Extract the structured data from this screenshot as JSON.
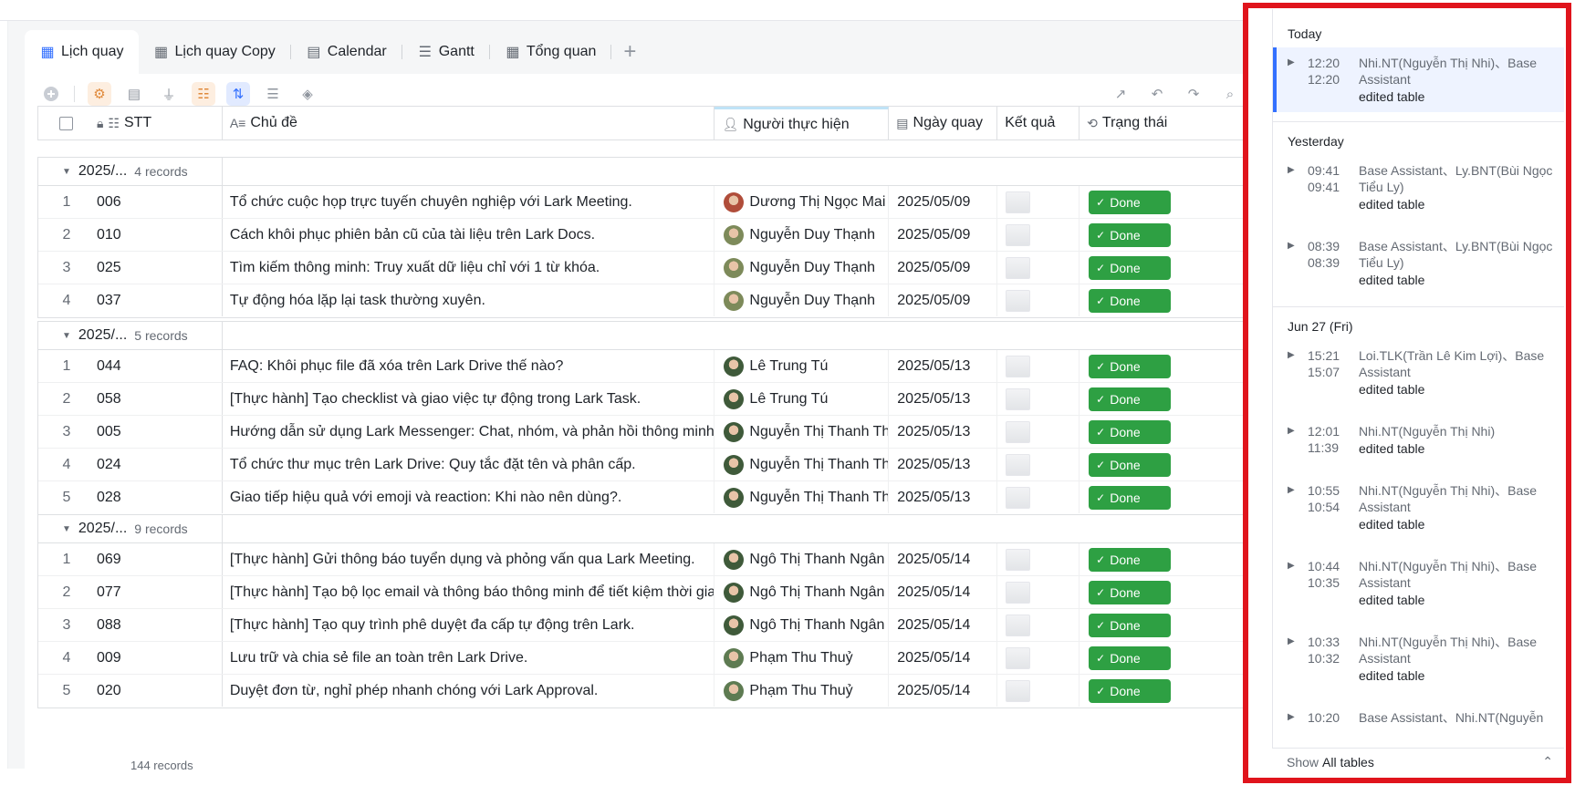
{
  "tabs": [
    {
      "label": "Lịch quay",
      "icon": "grid-icon",
      "active": true
    },
    {
      "label": "Lịch quay Copy",
      "icon": "grid-icon",
      "active": false
    },
    {
      "label": "Calendar",
      "icon": "calendar-icon",
      "active": false
    },
    {
      "label": "Gantt",
      "icon": "gantt-icon",
      "active": false
    },
    {
      "label": "Tổng quan",
      "icon": "grid-icon",
      "active": false
    }
  ],
  "tab_add": "+",
  "columns": {
    "stt": "STT",
    "topic": "Chủ đề",
    "person": "Người thực hiện",
    "date": "Ngày quay",
    "result": "Kết quả",
    "status": "Trạng thái"
  },
  "groups": [
    {
      "label": "2025/...",
      "count": "4 records",
      "rows": [
        {
          "idx": "1",
          "stt": "006",
          "topic": "Tổ chức cuộc họp trực tuyến chuyên nghiệp với Lark Meeting.",
          "person": "Dương Thị Ngọc Mai",
          "date": "2025/05/09",
          "status": "Done"
        },
        {
          "idx": "2",
          "stt": "010",
          "topic": "Cách khôi phục phiên bản cũ của tài liệu trên Lark Docs.",
          "person": "Nguyễn Duy Thạnh",
          "date": "2025/05/09",
          "status": "Done"
        },
        {
          "idx": "3",
          "stt": "025",
          "topic": "Tìm kiếm thông minh: Truy xuất dữ liệu chỉ với 1 từ khóa.",
          "person": "Nguyễn Duy Thạnh",
          "date": "2025/05/09",
          "status": "Done"
        },
        {
          "idx": "4",
          "stt": "037",
          "topic": "Tự động hóa lặp lại task thường xuyên.",
          "person": "Nguyễn Duy Thạnh",
          "date": "2025/05/09",
          "status": "Done"
        }
      ]
    },
    {
      "label": "2025/...",
      "count": "5 records",
      "rows": [
        {
          "idx": "1",
          "stt": "044",
          "topic": "FAQ: Khôi phục file đã xóa trên Lark Drive thế nào?",
          "person": "Lê Trung Tú",
          "date": "2025/05/13",
          "status": "Done"
        },
        {
          "idx": "2",
          "stt": "058",
          "topic": "[Thực hành] Tạo checklist và giao việc tự động trong Lark Task.",
          "person": "Lê Trung Tú",
          "date": "2025/05/13",
          "status": "Done"
        },
        {
          "idx": "3",
          "stt": "005",
          "topic": "Hướng dẫn sử dụng Lark Messenger: Chat, nhóm, và phản hồi thông minh.",
          "person": "Nguyễn Thị Thanh Thư",
          "date": "2025/05/13",
          "status": "Done"
        },
        {
          "idx": "4",
          "stt": "024",
          "topic": "Tổ chức thư mục trên Lark Drive: Quy tắc đặt tên và phân cấp.",
          "person": "Nguyễn Thị Thanh Thư",
          "date": "2025/05/13",
          "status": "Done"
        },
        {
          "idx": "5",
          "stt": "028",
          "topic": "Giao tiếp hiệu quả với emoji và reaction: Khi nào nên dùng?.",
          "person": "Nguyễn Thị Thanh Thư",
          "date": "2025/05/13",
          "status": "Done"
        }
      ]
    },
    {
      "label": "2025/...",
      "count": "9 records",
      "rows": [
        {
          "idx": "1",
          "stt": "069",
          "topic": "[Thực hành] Gửi thông báo tuyển dụng và phỏng vấn qua Lark Meeting.",
          "person": "Ngô Thị Thanh Ngân",
          "date": "2025/05/14",
          "status": "Done"
        },
        {
          "idx": "2",
          "stt": "077",
          "topic": "[Thực hành] Tạo bộ lọc email và thông báo thông minh để tiết kiệm thời gian.",
          "person": "Ngô Thị Thanh Ngân",
          "date": "2025/05/14",
          "status": "Done"
        },
        {
          "idx": "3",
          "stt": "088",
          "topic": "[Thực hành] Tạo quy trình phê duyệt đa cấp tự động trên Lark.",
          "person": "Ngô Thị Thanh Ngân",
          "date": "2025/05/14",
          "status": "Done"
        },
        {
          "idx": "4",
          "stt": "009",
          "topic": "Lưu trữ và chia sẻ file an toàn trên Lark Drive.",
          "person": "Phạm Thu Thuỷ",
          "date": "2025/05/14",
          "status": "Done"
        },
        {
          "idx": "5",
          "stt": "020",
          "topic": "Duyệt đơn từ, nghỉ phép nhanh chóng với Lark Approval.",
          "person": "Phạm Thu Thuỷ",
          "date": "2025/05/14",
          "status": "Done"
        }
      ]
    }
  ],
  "footer_count": "144 records",
  "history": {
    "sections": [
      {
        "title": "Today",
        "entries": [
          {
            "t1": "12:20",
            "t2": "12:20",
            "who": "Nhi.NT(Nguyễn Thị Nhi)、Base Assistant",
            "action": "edited table",
            "selected": true
          }
        ]
      },
      {
        "title": "Yesterday",
        "entries": [
          {
            "t1": "09:41",
            "t2": "09:41",
            "who": "Base Assistant、Ly.BNT(Bùi Ngọc Tiểu Ly)",
            "action": "edited table"
          },
          {
            "t1": "08:39",
            "t2": "08:39",
            "who": "Base Assistant、Ly.BNT(Bùi Ngọc Tiểu Ly)",
            "action": "edited table"
          }
        ]
      },
      {
        "title": "Jun 27 (Fri)",
        "entries": [
          {
            "t1": "15:21",
            "t2": "15:07",
            "who": "Loi.TLK(Trần Lê Kim Lợi)、Base Assistant",
            "action": "edited table"
          },
          {
            "t1": "12:01",
            "t2": "11:39",
            "who": "Nhi.NT(Nguyễn Thị Nhi)",
            "action": "edited table"
          },
          {
            "t1": "10:55",
            "t2": "10:54",
            "who": "Nhi.NT(Nguyễn Thị Nhi)、Base Assistant",
            "action": "edited table"
          },
          {
            "t1": "10:44",
            "t2": "10:35",
            "who": "Nhi.NT(Nguyễn Thị Nhi)、Base Assistant",
            "action": "edited table"
          },
          {
            "t1": "10:33",
            "t2": "10:32",
            "who": "Nhi.NT(Nguyễn Thị Nhi)、Base Assistant",
            "action": "edited table"
          },
          {
            "t1": "10:20",
            "t2": "",
            "who": "Base Assistant、Nhi.NT(Nguyễn",
            "action": ""
          }
        ]
      }
    ],
    "footer_show": "Show",
    "footer_scope": "All tables"
  },
  "colors": {
    "accent": "#3370ff",
    "done": "#2ea043",
    "highlight": "#e0141c"
  }
}
